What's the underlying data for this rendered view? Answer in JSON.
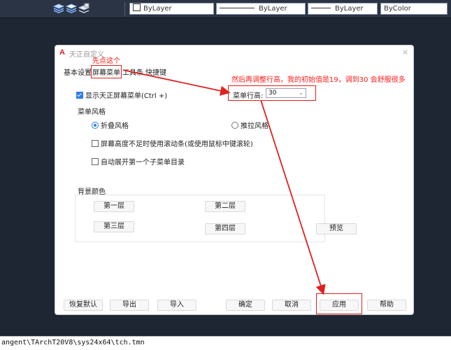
{
  "toolbar": {
    "icons": [
      "layer-match-icon",
      "layer-isolate-icon",
      "layer-lock-icon"
    ],
    "color_combo": "ByLayer",
    "linetype_combo": "ByLayer",
    "lineweight_combo": "ByLayer",
    "plotstyle_combo": "ByColor"
  },
  "dialog": {
    "logo": "A",
    "title": "天正自定义",
    "close": "×",
    "tabs": [
      "基本设置",
      "屏幕菜单",
      "工具条",
      "快捷键"
    ],
    "show_screen_menu": "显示天正屏幕菜单(Ctrl +)",
    "row_height_label": "菜单行高:",
    "row_height_value": "30",
    "menu_style_label": "菜单风格",
    "style_fold": "折叠风格",
    "style_pull": "推拉风格",
    "scrollbar_option": "屏幕高度不足时使用滚动条(或使用鼠标中键滚轮)",
    "auto_expand_option": "自动展开第一个子菜单目录",
    "bg_color_label": "背景颜色",
    "level_buttons": [
      "第一层",
      "第二层",
      "第三层",
      "第四层"
    ],
    "preview_button": "预览",
    "footer_buttons": {
      "restore": "恢复默认",
      "export": "导出",
      "import": "导入",
      "ok": "确定",
      "cancel": "取消",
      "apply": "应用",
      "help": "帮助"
    }
  },
  "annotations": {
    "first_click": "先点这个",
    "adjust_note": "然后再调整行高，我的初始值是19，调到30 会舒服很多"
  },
  "status_bar": {
    "path": "angent\\TArchT20V8\\sys24x64\\tch.tmn"
  },
  "colors": {
    "annotation_red": "#e02020",
    "accent_blue": "#2f7ee8",
    "background": "#1e2633"
  }
}
